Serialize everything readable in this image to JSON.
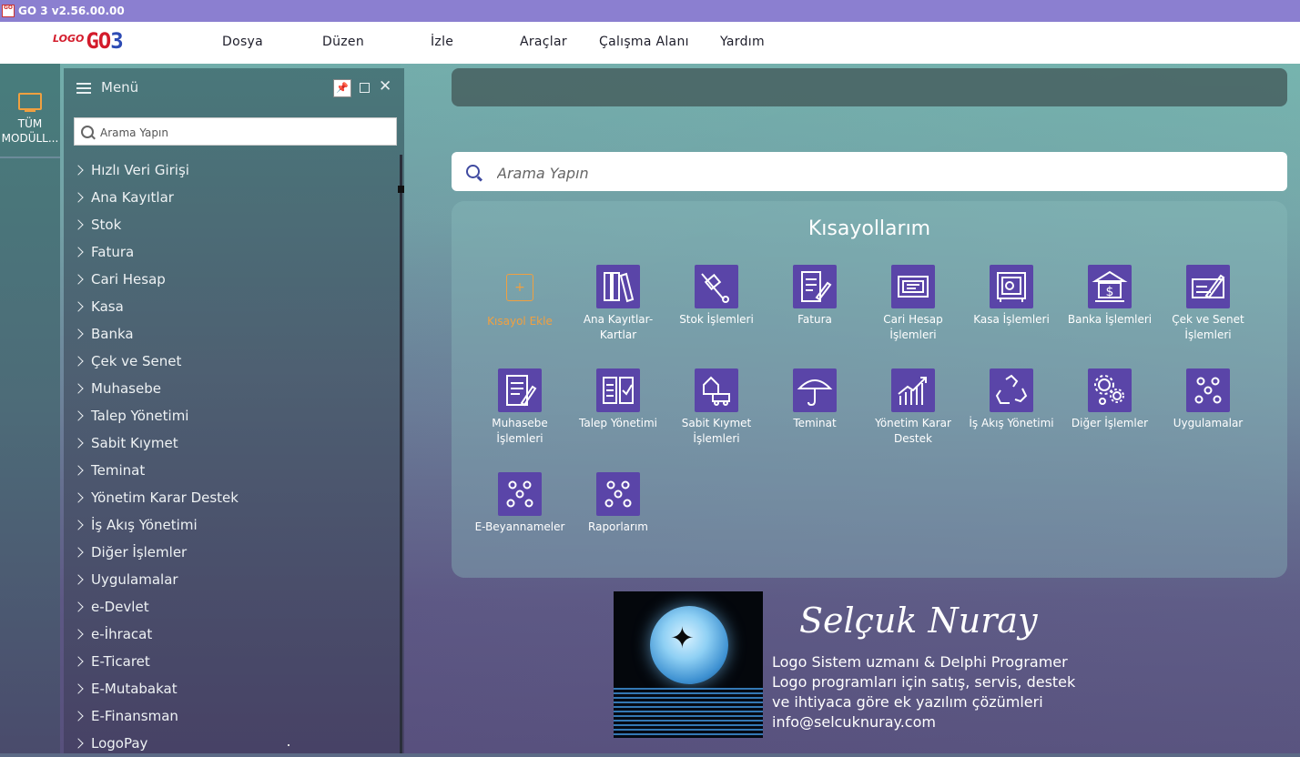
{
  "window": {
    "title": "GO 3 v2.56.00.00",
    "logo_small": "LOGO",
    "logo_go": "GO",
    "logo_3": "3"
  },
  "menubar": [
    {
      "label": "Dosya"
    },
    {
      "label": "Düzen"
    },
    {
      "label": "İzle"
    },
    {
      "label": "Araçlar"
    },
    {
      "label": "Çalışma Alanı"
    },
    {
      "label": "Yardım"
    }
  ],
  "left_strip": {
    "module_label_1": "TÜM",
    "module_label_2": "MODÜLL..."
  },
  "side_menu": {
    "title": "Menü",
    "search_placeholder": "Arama Yapın",
    "items": [
      "Hızlı Veri Girişi",
      "Ana Kayıtlar",
      "Stok",
      "Fatura",
      "Cari Hesap",
      "Kasa",
      "Banka",
      "Çek ve Senet",
      "Muhasebe",
      "Talep Yönetimi",
      "Sabit Kıymet",
      "Teminat",
      "Yönetim Karar Destek",
      "İş Akış Yönetimi",
      "Diğer İşlemler",
      "Uygulamalar",
      "e-Devlet",
      "e-İhracat",
      "E-Ticaret",
      "E-Mutabakat",
      "E-Finansman",
      "LogoPay"
    ]
  },
  "main_search": {
    "placeholder": "Arama Yapın"
  },
  "shortcuts": {
    "title": "Kısayollarım",
    "add_label": "Kısayol Ekle",
    "tiles": [
      {
        "label": "Ana Kayıtlar-Kartlar",
        "icon": "binders-icon"
      },
      {
        "label": "Stok İşlemleri",
        "icon": "hand-truck-icon"
      },
      {
        "label": "Fatura",
        "icon": "invoice-pen-icon"
      },
      {
        "label": "Cari Hesap İşlemleri",
        "icon": "id-card-icon"
      },
      {
        "label": "Kasa İşlemleri",
        "icon": "safe-icon"
      },
      {
        "label": "Banka İşlemleri",
        "icon": "bank-icon"
      },
      {
        "label": "Çek ve Senet İşlemleri",
        "icon": "cheque-icon"
      },
      {
        "label": "Muhasebe İşlemleri",
        "icon": "ledger-icon"
      },
      {
        "label": "Talep Yönetimi",
        "icon": "checklist-icon"
      },
      {
        "label": "Sabit Kıymet İşlemleri",
        "icon": "asset-truck-icon"
      },
      {
        "label": "Teminat",
        "icon": "umbrella-icon"
      },
      {
        "label": "Yönetim Karar Destek",
        "icon": "growth-chart-icon"
      },
      {
        "label": "İş Akış Yönetimi",
        "icon": "workflow-recycle-icon"
      },
      {
        "label": "Diğer İşlemler",
        "icon": "gears-icon"
      },
      {
        "label": "Uygulamalar",
        "icon": "dots-icon"
      },
      {
        "label": "E-Beyannameler",
        "icon": "dots-icon"
      },
      {
        "label": "Raporlarım",
        "icon": "dots-icon"
      }
    ]
  },
  "footer": {
    "name": "Selçuk Nuray",
    "line1": "Logo Sistem uzmanı & Delphi Programer",
    "line2": "Logo programları için satış, servis, destek",
    "line3": "ve ihtiyaca göre ek yazılım çözümleri",
    "line4": "info@selcuknuray.com"
  },
  "colors": {
    "accent": "#5a45a8",
    "titlebar": "#8b7fd0",
    "add_accent": "#f0a040"
  }
}
